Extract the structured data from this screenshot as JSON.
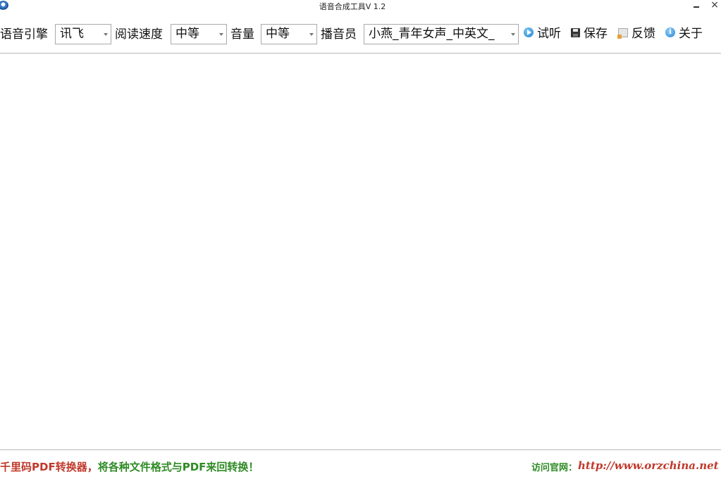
{
  "window": {
    "title": "语音合成工具V 1.2",
    "minimize_label": "",
    "close_label": "×"
  },
  "toolbar": {
    "engine_label": "语音引擎",
    "engine_value": "讯飞",
    "speed_label": "阅读速度",
    "speed_value": "中等",
    "volume_label": "音量",
    "volume_value": "中等",
    "speaker_label": "播音员",
    "speaker_value": "小燕_青年女声_中英文_",
    "listen_label": "试听",
    "save_label": "保存",
    "feedback_label": "反馈",
    "about_label": "关于"
  },
  "editor": {
    "value": ""
  },
  "footer": {
    "promo_part1": "千里码PDF转换器，",
    "promo_part2": "将各种文件格式与PDF来回转换！",
    "visit_label": "访问官网：",
    "site_url": "http://www.orzchina.net"
  },
  "colors": {
    "promo_red": "#c0392b",
    "promo_green": "#2e8b24",
    "border_gray": "#a9a9a9"
  },
  "icons": {
    "app": "app-logo-icon",
    "listen": "play-icon",
    "save": "floppy-disk-icon",
    "feedback": "feedback-icon",
    "about": "info-icon"
  }
}
